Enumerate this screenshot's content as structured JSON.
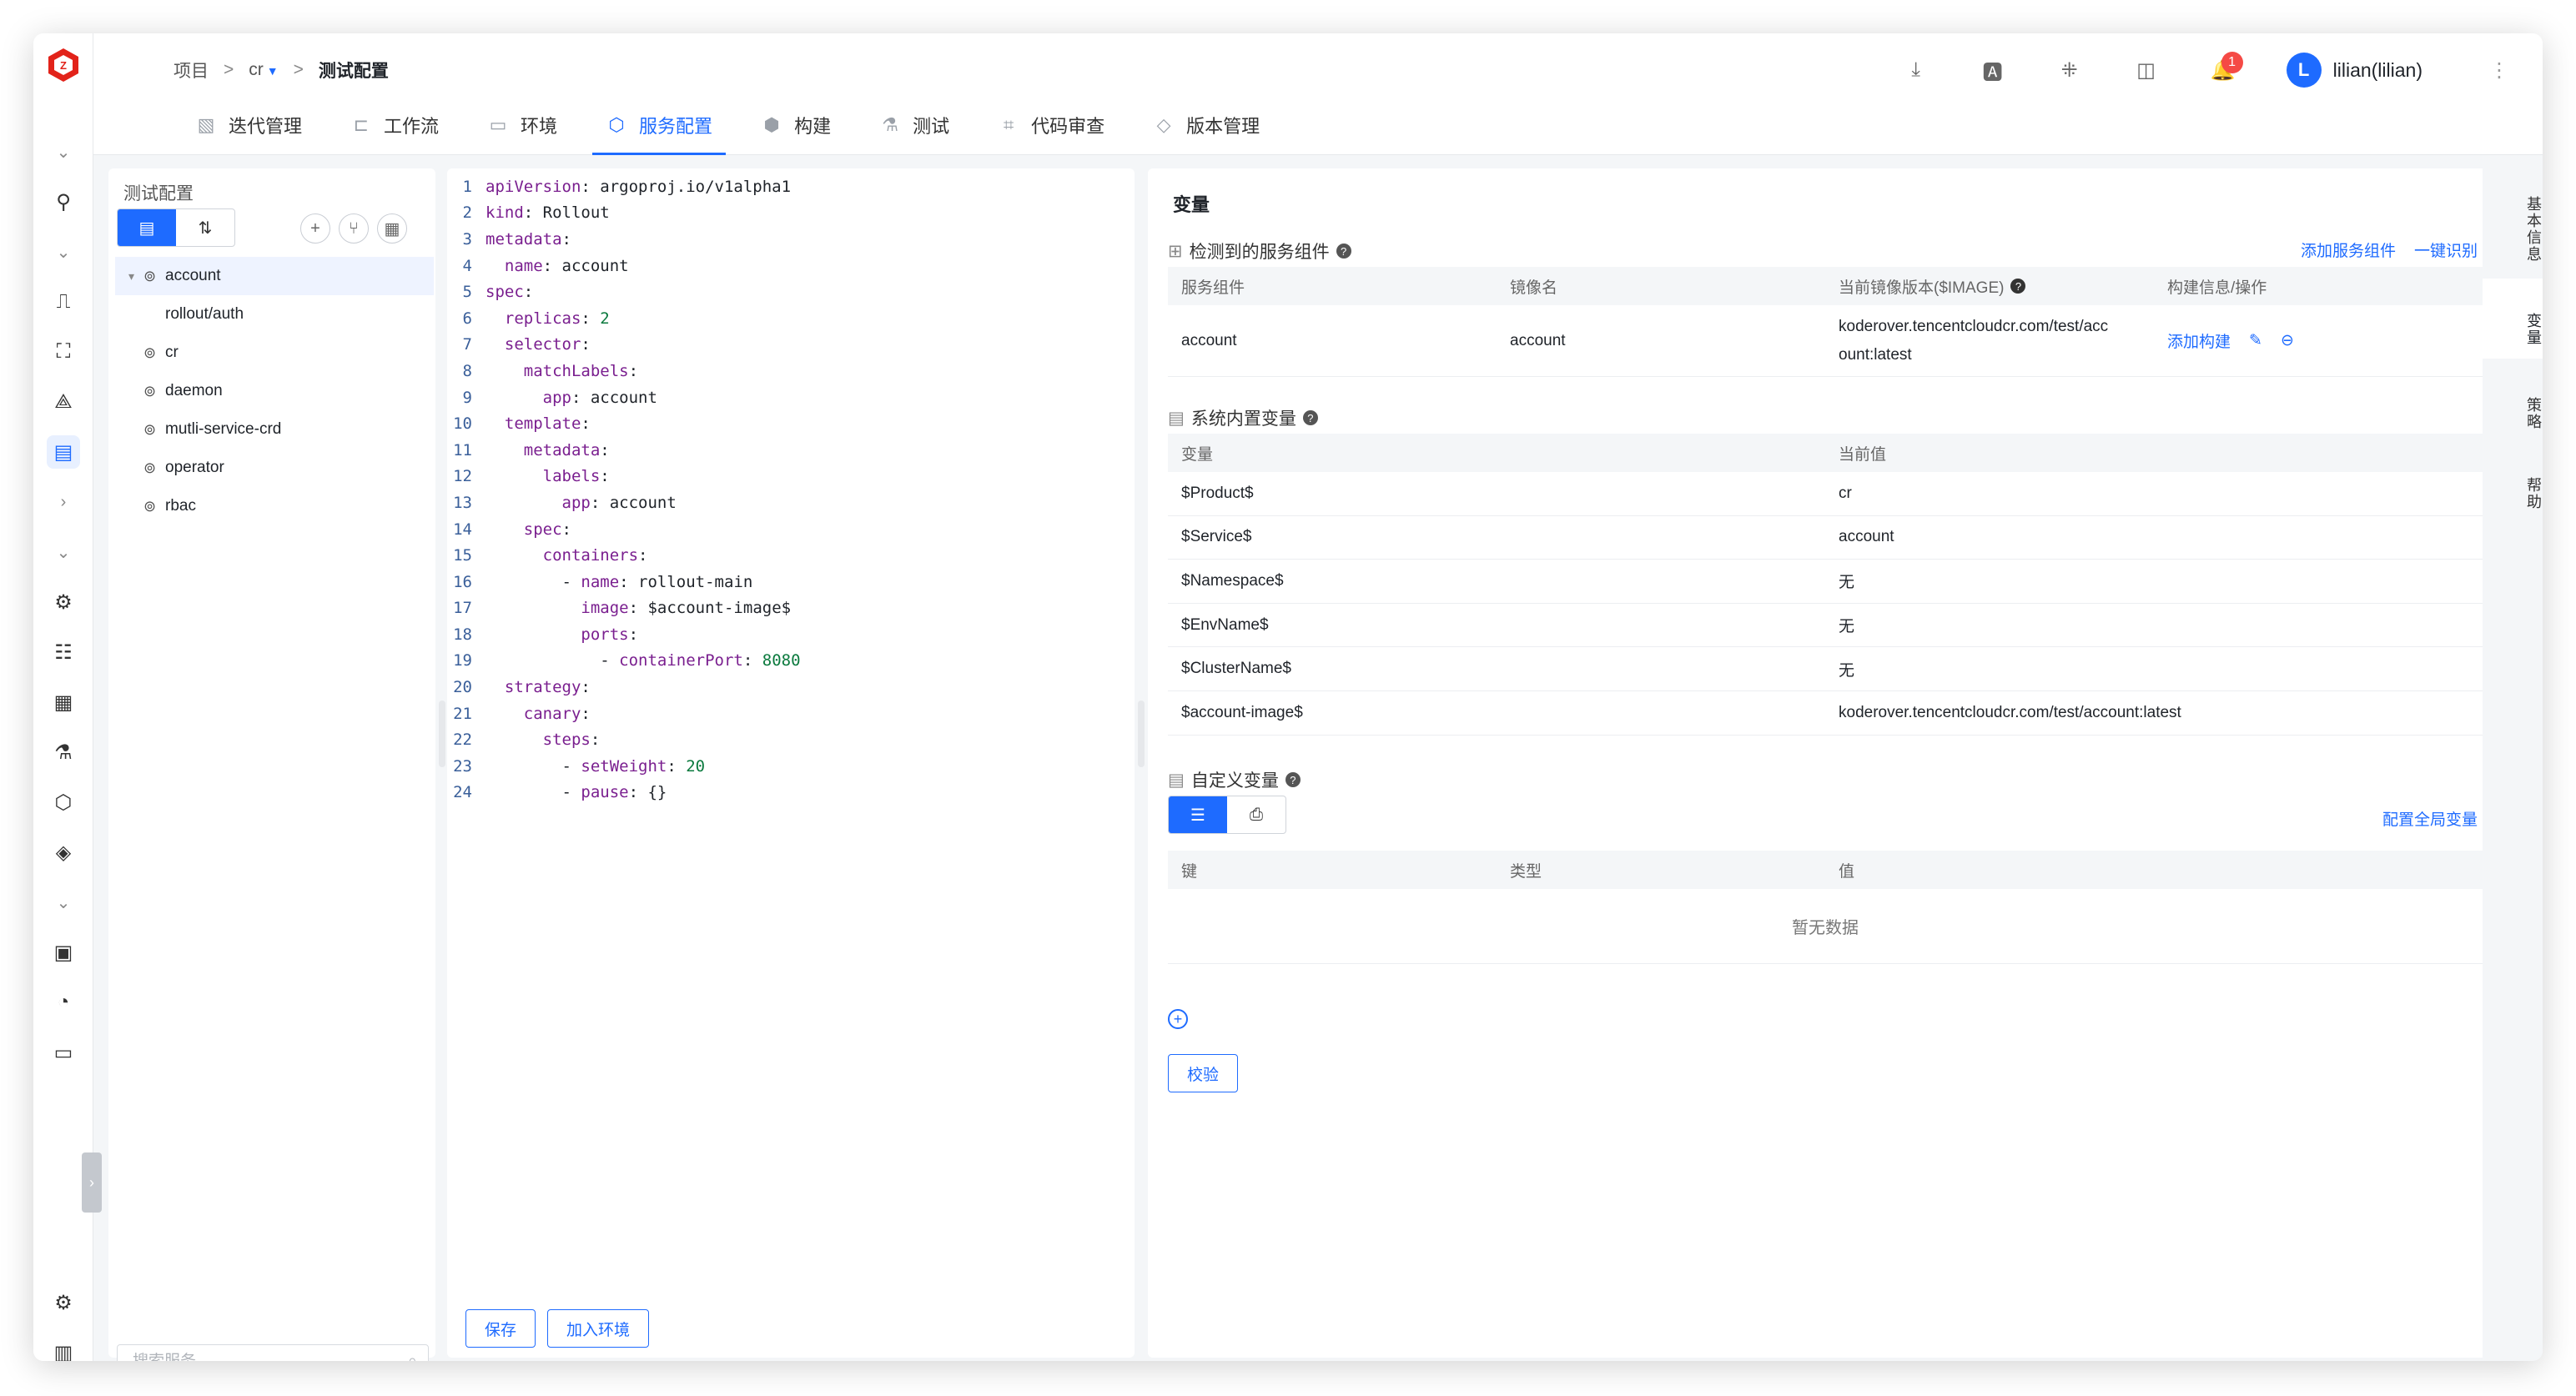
{
  "header": {
    "breadcrumb": {
      "root": "项目",
      "sep1": ">",
      "project": "cr",
      "sep2": ">",
      "current": "测试配置"
    },
    "notifications_count": "1",
    "user": {
      "initial": "L",
      "name": "lilian(lilian)"
    },
    "icons": [
      "download-icon",
      "translate-icon",
      "dots-grid-icon",
      "book-icon",
      "bell-icon",
      "more-icon"
    ]
  },
  "tabs": [
    {
      "label": "迭代管理",
      "icon": "iteration-icon"
    },
    {
      "label": "工作流",
      "icon": "workflow-icon"
    },
    {
      "label": "环境",
      "icon": "env-icon"
    },
    {
      "label": "服务配置",
      "icon": "service-icon",
      "active": true
    },
    {
      "label": "构建",
      "icon": "build-icon"
    },
    {
      "label": "测试",
      "icon": "flask-icon"
    },
    {
      "label": "代码审查",
      "icon": "scan-icon"
    },
    {
      "label": "版本管理",
      "icon": "version-icon"
    }
  ],
  "tree": {
    "title": "测试配置",
    "items": [
      {
        "label": "account",
        "expanded": true,
        "selected": true
      },
      {
        "label": "rollout/auth",
        "child": true
      },
      {
        "label": "cr"
      },
      {
        "label": "daemon"
      },
      {
        "label": "mutli-service-crd"
      },
      {
        "label": "operator"
      },
      {
        "label": "rbac"
      }
    ],
    "search_placeholder": "搜索服务"
  },
  "editor": {
    "lines": [
      {
        "no": "1",
        "indent": "",
        "key": "apiVersion",
        "value": " argoproj.io/v1alpha1"
      },
      {
        "no": "2",
        "indent": "",
        "key": "kind",
        "value": " Rollout"
      },
      {
        "no": "3",
        "indent": "",
        "key": "metadata",
        "value": ""
      },
      {
        "no": "4",
        "indent": "  ",
        "key": "name",
        "value": " account"
      },
      {
        "no": "5",
        "indent": "",
        "key": "spec",
        "value": ""
      },
      {
        "no": "6",
        "indent": "  ",
        "key": "replicas",
        "value": " 2",
        "num": true
      },
      {
        "no": "7",
        "indent": "  ",
        "key": "selector",
        "value": ""
      },
      {
        "no": "8",
        "indent": "    ",
        "key": "matchLabels",
        "value": ""
      },
      {
        "no": "9",
        "indent": "      ",
        "key": "app",
        "value": " account"
      },
      {
        "no": "10",
        "indent": "  ",
        "key": "template",
        "value": ""
      },
      {
        "no": "11",
        "indent": "    ",
        "key": "metadata",
        "value": ""
      },
      {
        "no": "12",
        "indent": "      ",
        "key": "labels",
        "value": ""
      },
      {
        "no": "13",
        "indent": "        ",
        "key": "app",
        "value": " account"
      },
      {
        "no": "14",
        "indent": "    ",
        "key": "spec",
        "value": ""
      },
      {
        "no": "15",
        "indent": "      ",
        "key": "containers",
        "value": ""
      },
      {
        "no": "16",
        "indent": "        - ",
        "key": "name",
        "value": " rollout-main"
      },
      {
        "no": "17",
        "indent": "          ",
        "key": "image",
        "value": " $account-image$"
      },
      {
        "no": "18",
        "indent": "          ",
        "key": "ports",
        "value": ""
      },
      {
        "no": "19",
        "indent": "            - ",
        "key": "containerPort",
        "value": " 8080",
        "num": true
      },
      {
        "no": "20",
        "indent": "  ",
        "key": "strategy",
        "value": ""
      },
      {
        "no": "21",
        "indent": "    ",
        "key": "canary",
        "value": ""
      },
      {
        "no": "22",
        "indent": "      ",
        "key": "steps",
        "value": ""
      },
      {
        "no": "23",
        "indent": "        - ",
        "key": "setWeight",
        "value": " 20",
        "num": true
      },
      {
        "no": "24",
        "indent": "        - ",
        "key": "pause",
        "value": " {}"
      }
    ],
    "save_label": "保存",
    "join_env_label": "加入环境"
  },
  "variables": {
    "title": "变量",
    "detected": {
      "title": "检测到的服务组件",
      "add_component": "添加服务组件",
      "auto_detect": "一键识别",
      "columns": [
        "服务组件",
        "镜像名",
        "当前镜像版本($IMAGE)",
        "构建信息/操作"
      ],
      "rows": [
        {
          "component": "account",
          "image": "account",
          "version_line1": "koderover.tencentcloudcr.com/test/acc",
          "version_line2": "ount:latest",
          "action": "添加构建"
        }
      ]
    },
    "system": {
      "title": "系统内置变量",
      "columns": [
        "变量",
        "当前值"
      ],
      "rows": [
        {
          "name": "$Product$",
          "value": "cr"
        },
        {
          "name": "$Service$",
          "value": "account"
        },
        {
          "name": "$Namespace$",
          "value": "无"
        },
        {
          "name": "$EnvName$",
          "value": "无"
        },
        {
          "name": "$ClusterName$",
          "value": "无"
        },
        {
          "name": "$account-image$",
          "value": "koderover.tencentcloudcr.com/test/account:latest"
        }
      ]
    },
    "custom": {
      "title": "自定义变量",
      "global_link": "配置全局变量",
      "columns": [
        "键",
        "类型",
        "值"
      ],
      "empty_text": "暂无数据",
      "validate_label": "校验"
    }
  },
  "side_tabs": [
    {
      "label": "基本信息"
    },
    {
      "label": "变量",
      "active": true
    },
    {
      "label": "策略"
    },
    {
      "label": "帮助"
    }
  ],
  "colors": {
    "accent": "#1e6bff",
    "badge": "#f54a45"
  }
}
